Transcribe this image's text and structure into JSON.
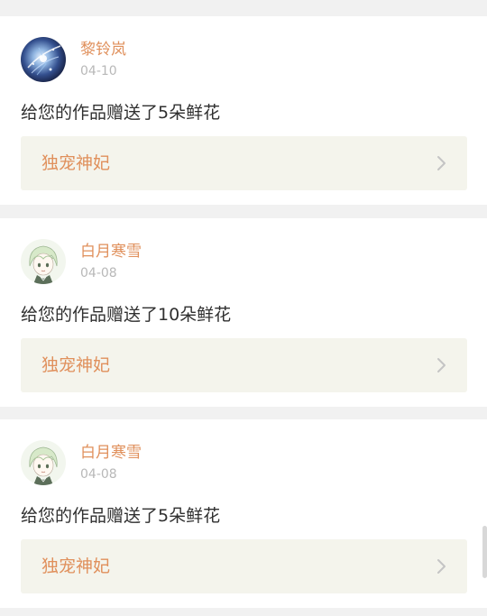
{
  "notifications": [
    {
      "username": "黎铃岚",
      "date": "04-10",
      "message": "给您的作品赠送了5朵鲜花",
      "work_title": "独宠神妃",
      "avatar_icon": "galaxy-art-avatar"
    },
    {
      "username": "白月寒雪",
      "date": "04-08",
      "message": "给您的作品赠送了10朵鲜花",
      "work_title": "独宠神妃",
      "avatar_icon": "anime-girl-avatar"
    },
    {
      "username": "白月寒雪",
      "date": "04-08",
      "message": "给您的作品赠送了5朵鲜花",
      "work_title": "独宠神妃",
      "avatar_icon": "anime-girl-avatar"
    }
  ],
  "colors": {
    "accent": "#e0905c",
    "date": "#b8b8b8",
    "text": "#2f2f2f",
    "link_bg": "#f4f4ec",
    "page_bg": "#f1f1f1"
  }
}
